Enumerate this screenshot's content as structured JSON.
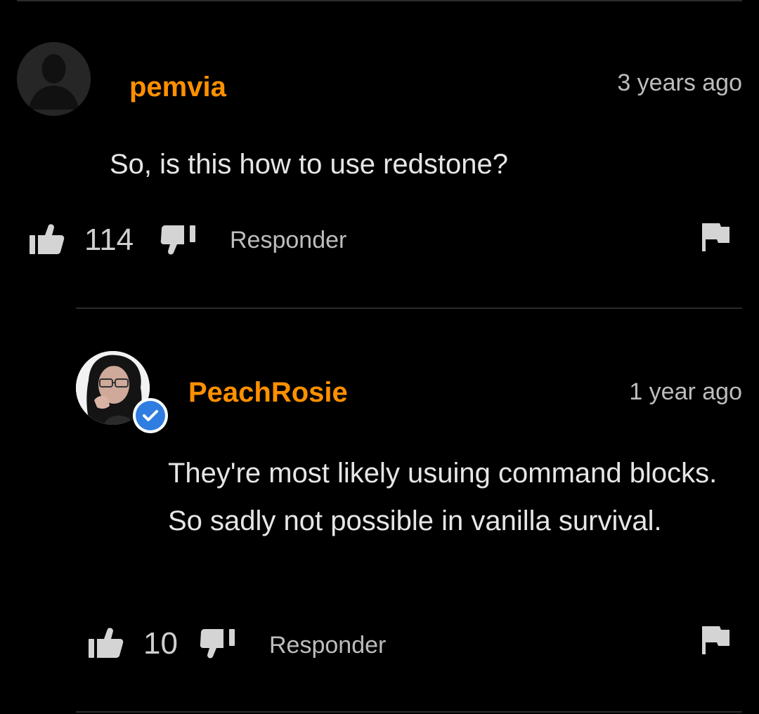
{
  "comments": [
    {
      "username": "pemvia",
      "timestamp": "3 years ago",
      "text": "So, is this how to use redstone?",
      "likes": "114",
      "reply_label": "Responder",
      "avatar": "default-user-silhouette",
      "verified": false
    },
    {
      "username": "PeachRosie",
      "timestamp": "1 year ago",
      "text": "They're most likely usuing command blocks. So sadly not possible in vanilla survival.",
      "likes": "10",
      "reply_label": "Responder",
      "avatar": "user-photo",
      "verified": true
    }
  ],
  "icons": {
    "like": "thumbs-up-icon",
    "dislike": "thumbs-down-icon",
    "flag": "flag-icon",
    "verified": "verified-check-icon"
  },
  "colors": {
    "background": "#000000",
    "username": "#ff9000",
    "verified": "#2f7de1",
    "text": "#e6e6e6",
    "muted": "#bdbdbd"
  }
}
